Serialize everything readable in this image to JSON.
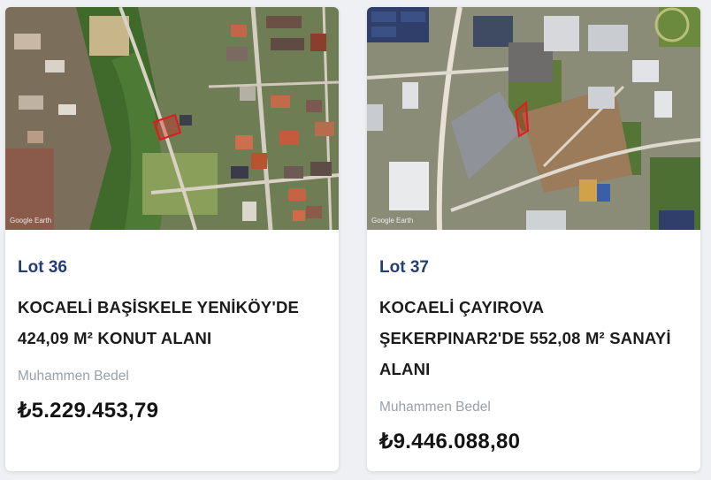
{
  "listings": [
    {
      "lot": "Lot 36",
      "title_line1": "KOCAELİ BAŞİSKELE YENİKÖY'DE",
      "title_line2": "424,09 M² KONUT ALANI",
      "price_label": "Muhammen Bedel",
      "price": "₺5.229.453,79",
      "map_watermark": "Google Earth",
      "map_type": "satellite-residential"
    },
    {
      "lot": "Lot 37",
      "title_line1": "KOCAELİ ÇAYIROVA",
      "title_line2": "ŞEKERPINAR2'DE 552,08 M² SANAYİ",
      "title_line3": "ALANI",
      "price_label": "Muhammen Bedel",
      "price": "₺9.446.088,80",
      "map_watermark": "Google Earth",
      "map_type": "satellite-industrial"
    }
  ],
  "colors": {
    "lot_accent": "#243f73",
    "parcel_outline": "#e01b1b",
    "muted_label": "#98a0aa"
  }
}
